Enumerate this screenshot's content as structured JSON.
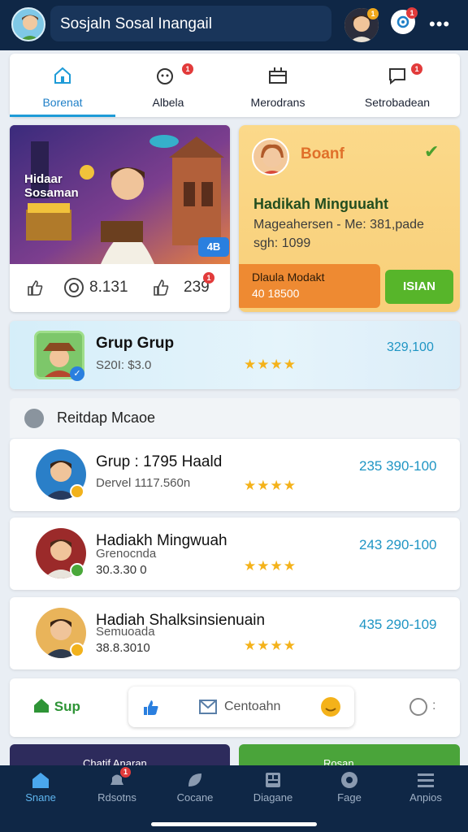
{
  "header": {
    "title": "Sosjaln Sosal Inangail",
    "avatar_icon": "user-avatar-icon",
    "profile_badge": "1",
    "notification_badge": "1"
  },
  "tabs": [
    {
      "label": "Borenat",
      "icon": "home-icon",
      "active": true
    },
    {
      "label": "Albela",
      "icon": "notification-icon",
      "badge": "1"
    },
    {
      "label": "Merodrans",
      "icon": "inbox-icon"
    },
    {
      "label": "Setrobadean",
      "icon": "chat-icon",
      "badge": "1"
    }
  ],
  "hero": {
    "image_text": "Hidaar Sosaman",
    "chip": "4B",
    "stat_views": "8.131",
    "stat_likes": "239",
    "likes_badge": "1"
  },
  "reward": {
    "badge": "Boanf",
    "title": "Hadikah Minguuaht",
    "desc_line1": "Mageahersen - Me: 381,pade",
    "desc_line2": "sgh: 1099",
    "foot_title": "Dlaula Modakt",
    "foot_value": "40 18500",
    "button": "ISIAN"
  },
  "featured": {
    "title": "Grup Grup",
    "sub": "S20I: $3.0",
    "count": "329,100",
    "stars": "★★★★"
  },
  "section": {
    "title": "Reitdap Mcaoe"
  },
  "rows": [
    {
      "title": "Grup  : 1795 Haald",
      "sub": "Dervel 1117.560n",
      "sub2": "",
      "count": "235 390-100",
      "stars": "★★★★"
    },
    {
      "title": "Hadiakh Mingwuah",
      "sub": "Grenocnda",
      "sub2": "30.3.30 0",
      "count": "243 290-100",
      "stars": "★★★★"
    },
    {
      "title": "Hadiah Shalksinsienuain",
      "sub": "Semuoada",
      "sub2": "38.8.3010",
      "count": "435 290-109",
      "stars": "★★★★"
    }
  ],
  "actionbar": {
    "home_label": "Sup",
    "message_label": "Centoahn"
  },
  "peek": {
    "left": "Chatif Anaran",
    "right": "Rosan"
  },
  "bottom_nav": [
    {
      "label": "Snane",
      "icon": "home-icon",
      "active": true
    },
    {
      "label": "Rdsotns",
      "icon": "notification-icon",
      "badge": "1"
    },
    {
      "label": "Cocane",
      "icon": "leaf-icon"
    },
    {
      "label": "Diagane",
      "icon": "grid-icon"
    },
    {
      "label": "Fage",
      "icon": "globe-icon"
    },
    {
      "label": "Anpios",
      "icon": "menu-icon"
    }
  ],
  "colors": {
    "header_bg": "#0f2746",
    "accent_blue": "#1e9bd7",
    "reward_bg": "#fbd98a",
    "success_green": "#57b52a"
  }
}
